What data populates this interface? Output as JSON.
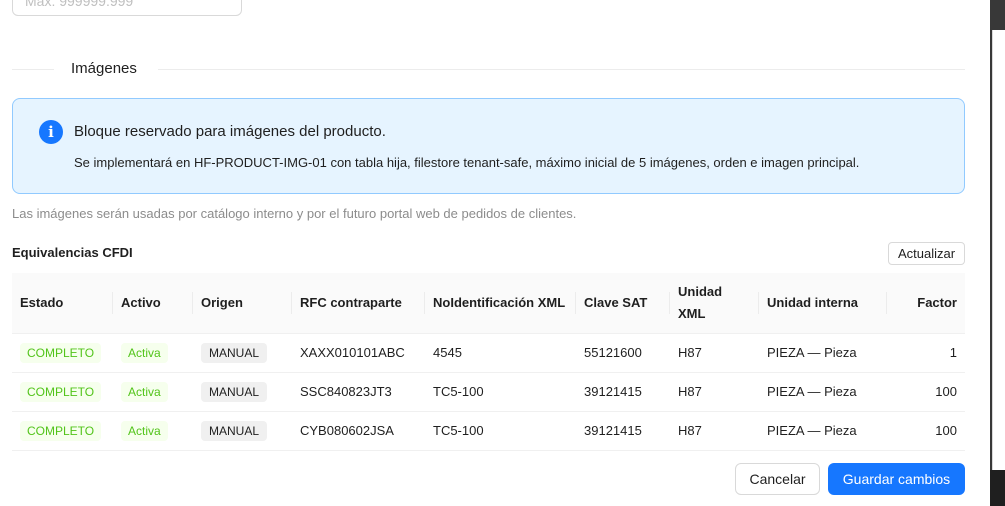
{
  "max_field": {
    "placeholder": "Max. 999999.999"
  },
  "images_section": {
    "title": "Imágenes",
    "info_title": "Bloque reservado para imágenes del producto.",
    "info_desc": "Se implementará en HF-PRODUCT-IMG-01 con tabla hija, filestore tenant-safe, máximo inicial de 5 imágenes, orden e imagen principal.",
    "info_icon": "info-circle-icon",
    "help_text": "Las imágenes serán usadas por catálogo interno y por el futuro portal web de pedidos de clientes."
  },
  "cfdi": {
    "title": "Equivalencias CFDI",
    "refresh_label": "Actualizar",
    "columns": [
      "Estado",
      "Activo",
      "Origen",
      "RFC contraparte",
      "NoIdentificación XML",
      "Clave SAT",
      "Unidad XML",
      "Unidad interna",
      "Factor"
    ],
    "rows": [
      {
        "estado": "COMPLETO",
        "activo": "Activa",
        "origen": "MANUAL",
        "rfc": "XAXX010101ABC",
        "noident": "4545",
        "clave_sat": "55121600",
        "unidad_xml": "H87",
        "unidad_interna": "PIEZA — Pieza",
        "factor": "1"
      },
      {
        "estado": "COMPLETO",
        "activo": "Activa",
        "origen": "MANUAL",
        "rfc": "SSC840823JT3",
        "noident": "TC5-100",
        "clave_sat": "39121415",
        "unidad_xml": "H87",
        "unidad_interna": "PIEZA — Pieza",
        "factor": "100"
      },
      {
        "estado": "COMPLETO",
        "activo": "Activa",
        "origen": "MANUAL",
        "rfc": "CYB080602JSA",
        "noident": "TC5-100",
        "clave_sat": "39121415",
        "unidad_xml": "H87",
        "unidad_interna": "PIEZA — Pieza",
        "factor": "100"
      }
    ]
  },
  "footer": {
    "cancel_label": "Cancelar",
    "save_label": "Guardar cambios"
  },
  "colors": {
    "primary": "#1677ff",
    "success": "#52c41a",
    "info_bg": "#e6f4ff",
    "info_border": "#91caff"
  }
}
